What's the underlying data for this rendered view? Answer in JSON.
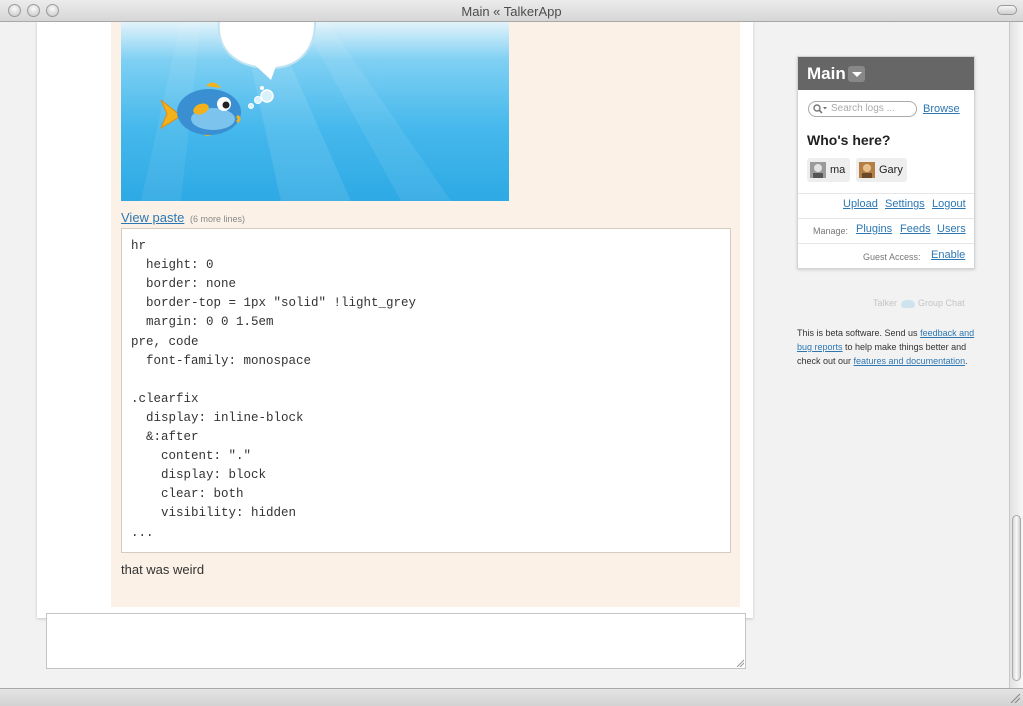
{
  "window": {
    "title": "Main « TalkerApp"
  },
  "log": {
    "paste_link": "View paste",
    "paste_meta": "(6 more lines)",
    "code_lines": [
      "hr",
      "  height: 0",
      "  border: none",
      "  border-top = 1px \"solid\" !light_grey",
      "  margin: 0 0 1.5em",
      "pre, code",
      "  font-family: monospace",
      "",
      ".clearfix",
      "  display: inline-block",
      "  &:after",
      "    content: \".\"",
      "    display: block",
      "    clear: both",
      "    visibility: hidden",
      "..."
    ],
    "message": "that was weird"
  },
  "composer": {
    "value": ""
  },
  "sidebar": {
    "room": "Main",
    "search_placeholder": "Search logs ...",
    "browse": "Browse",
    "whos_here": "Who's here?",
    "users": [
      {
        "name": "ma"
      },
      {
        "name": "Gary"
      }
    ],
    "upload": "Upload",
    "settings": "Settings",
    "logout": "Logout",
    "manage_label": "Manage:",
    "plugins": "Plugins",
    "feeds": "Feeds",
    "users_link": "Users",
    "guest_label": "Guest Access:",
    "enable": "Enable",
    "brand_left": "Talker",
    "brand_right": "Group Chat",
    "beta_pre": "This is beta software. Send us ",
    "beta_link1": "feedback and bug reports",
    "beta_mid": " to help make things better and check out our ",
    "beta_link2": "features and documentation",
    "beta_end": "."
  },
  "colors": {
    "link": "#2d78b3",
    "message_bg": "#fbf1e6",
    "panel_header": "#666666"
  },
  "icons": [
    "search-icon",
    "chevron-down-icon",
    "avatar",
    "resize-grip-icon"
  ]
}
